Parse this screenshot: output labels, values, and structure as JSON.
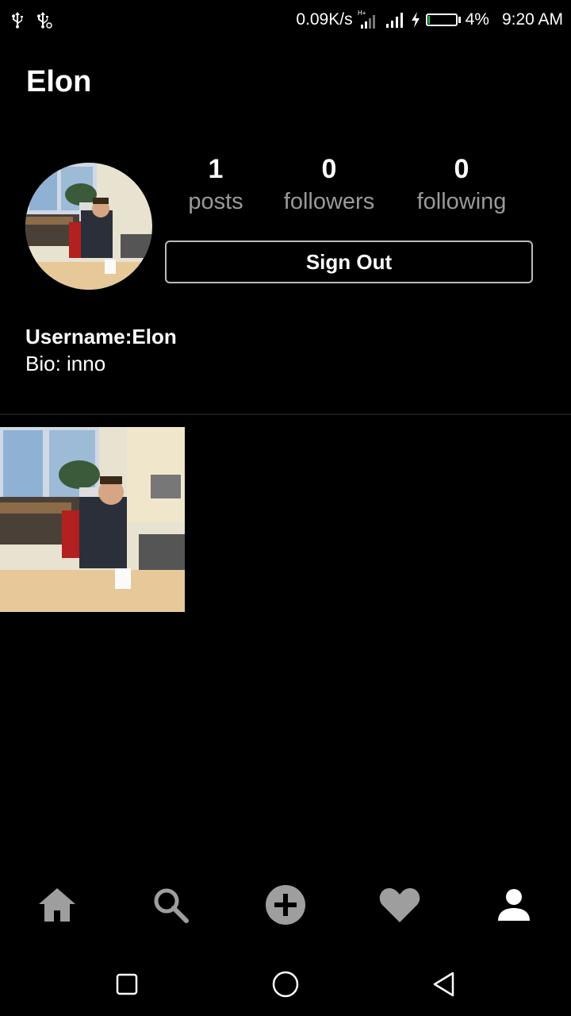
{
  "status_bar": {
    "left_icons": [
      "usb-icon",
      "usb-debug-icon"
    ],
    "net_speed": "0.09K/s",
    "network_type": "H+",
    "battery_pct": "4%",
    "time": "9:20 AM",
    "battery_level": 0.04
  },
  "profile": {
    "name": "Elon",
    "stats": [
      {
        "value": "1",
        "label": "posts"
      },
      {
        "value": "0",
        "label": "followers"
      },
      {
        "value": "0",
        "label": "following"
      }
    ],
    "sign_out_label": "Sign Out",
    "username_line": "Username:Elon",
    "bio_line": "Bio: inno"
  },
  "posts": [
    {
      "icon": "office-photo"
    }
  ],
  "bottom_nav": {
    "items": [
      {
        "icon": "home-icon",
        "active": false
      },
      {
        "icon": "search-icon",
        "active": false
      },
      {
        "icon": "add-icon",
        "active": false
      },
      {
        "icon": "heart-icon",
        "active": false
      },
      {
        "icon": "person-icon",
        "active": true
      }
    ],
    "active_color": "#ffffff",
    "inactive_color": "#9e9e9e"
  },
  "system_nav": [
    "recents-icon",
    "home-circle-icon",
    "back-icon"
  ]
}
